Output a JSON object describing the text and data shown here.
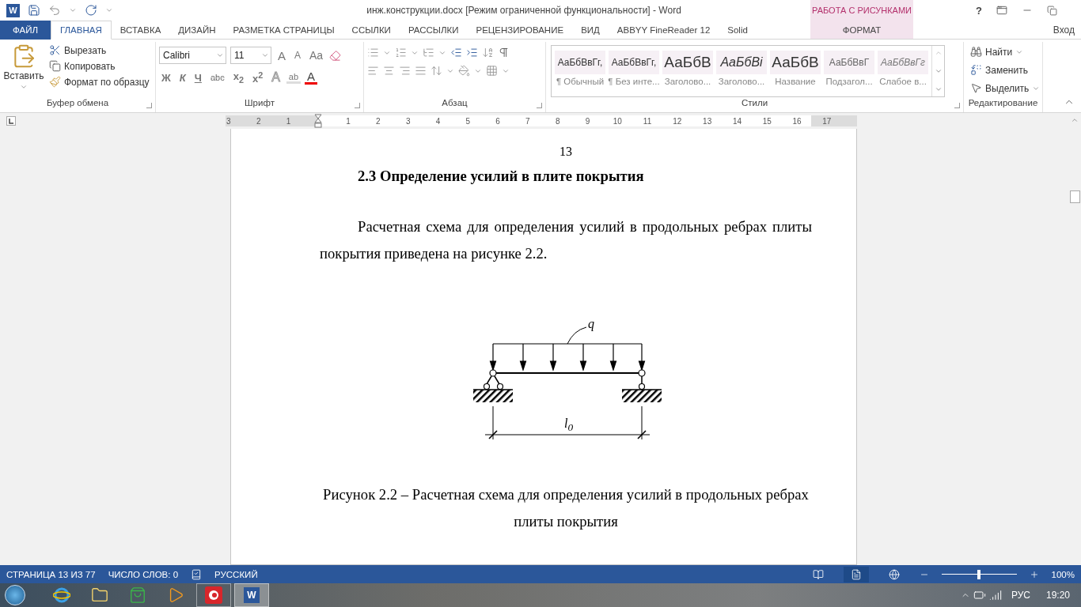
{
  "title_bar": {
    "logo": "W",
    "title": "инж.конструкции.docx [Режим ограниченной функциональности] - Word",
    "context_group": "РАБОТА С РИСУНКАМИ",
    "help": "?"
  },
  "tabs": [
    {
      "label": "ФАЙЛ",
      "kind": "file",
      "selected": false
    },
    {
      "label": "ГЛАВНАЯ",
      "kind": "normal",
      "selected": true
    },
    {
      "label": "ВСТАВКА",
      "kind": "normal",
      "selected": false
    },
    {
      "label": "ДИЗАЙН",
      "kind": "normal",
      "selected": false
    },
    {
      "label": "РАЗМЕТКА СТРАНИЦЫ",
      "kind": "normal",
      "selected": false
    },
    {
      "label": "ССЫЛКИ",
      "kind": "normal",
      "selected": false
    },
    {
      "label": "РАССЫЛКИ",
      "kind": "normal",
      "selected": false
    },
    {
      "label": "РЕЦЕНЗИРОВАНИЕ",
      "kind": "normal",
      "selected": false
    },
    {
      "label": "ВИД",
      "kind": "normal",
      "selected": false
    },
    {
      "label": "ABBYY FineReader 12",
      "kind": "normal",
      "selected": false
    },
    {
      "label": "Solid",
      "kind": "normal",
      "selected": false
    },
    {
      "label": "ФОРМАТ",
      "kind": "context",
      "selected": false
    }
  ],
  "account": "Вход",
  "clipboard": {
    "paste": "Вставить",
    "cut": "Вырезать",
    "copy": "Копировать",
    "format_painter": "Формат по образцу",
    "label": "Буфер обмена"
  },
  "font": {
    "name": "Calibri",
    "size": "11",
    "label": "Шрифт",
    "size_buttons": [
      {
        "kind": "grow",
        "text": "A"
      },
      {
        "kind": "shrink",
        "text": "A"
      },
      {
        "kind": "case",
        "text": "Aa"
      }
    ],
    "format_buttons": [
      {
        "kind": "bold",
        "text": "Ж"
      },
      {
        "kind": "italic",
        "text": "К"
      },
      {
        "kind": "underline",
        "text": "Ч"
      },
      {
        "kind": "strike",
        "text": "abc"
      },
      {
        "kind": "sub",
        "text": "x$_{2}$"
      },
      {
        "kind": "sup",
        "text": "x$^{2}$"
      },
      {
        "kind": "effects",
        "text": "A"
      },
      {
        "kind": "highlight",
        "text": "ab"
      },
      {
        "kind": "color",
        "text": "A"
      }
    ]
  },
  "paragraph": {
    "label": "Абзац"
  },
  "styles": {
    "label": "Стили",
    "items": [
      {
        "preview": "АаБбВвГг,",
        "name": "¶ Обычный",
        "kind": "normal"
      },
      {
        "preview": "АаБбВвГг,",
        "name": "¶ Без инте...",
        "kind": "normal"
      },
      {
        "preview": "АаБбВ",
        "name": "Заголово...",
        "kind": "heading"
      },
      {
        "preview": "АаБбВі",
        "name": "Заголово...",
        "kind": "heading_italic"
      },
      {
        "preview": "АаБбВ",
        "name": "Название",
        "kind": "title"
      },
      {
        "preview": "АаБбВвГ",
        "name": "Подзагол...",
        "kind": "subtitle"
      },
      {
        "preview": "АаБбВвГг",
        "name": "Слабое в...",
        "kind": "subtle"
      }
    ]
  },
  "editing": {
    "find": "Найти",
    "replace": "Заменить",
    "select": "Выделить",
    "label": "Редактирование"
  },
  "ruler": {
    "left_marks": [
      "3",
      "2",
      "1"
    ],
    "right_marks": [
      "1",
      "2",
      "3",
      "4",
      "5",
      "6",
      "7",
      "8",
      "9",
      "10",
      "11",
      "12",
      "13",
      "14",
      "15",
      "16",
      "17"
    ]
  },
  "document": {
    "page_number": "13",
    "heading": "2.3 Определение усилий в плите покрытия",
    "paragraph": "Расчетная схема для определения усилий в продольных ребрах плиты покрытия приведена на рисунке 2.2.",
    "figure": {
      "load_label": "q",
      "span_label": "l$_{0}$"
    },
    "caption": "Рисунок 2.2 – Расчетная схема для определения усилий в продольных ребрах плиты покрытия"
  },
  "status_bar": {
    "page": "СТРАНИЦА 13 ИЗ 77",
    "words": "ЧИСЛО СЛОВ: 0",
    "language": "РУССКИЙ",
    "views": [
      {
        "kind": "read",
        "selected": false
      },
      {
        "kind": "print",
        "selected": true
      },
      {
        "kind": "web",
        "selected": false
      }
    ],
    "zoom": {
      "level": 0.5,
      "reading": "100%"
    }
  },
  "taskbar": {
    "apps": [
      {
        "kind": "browser",
        "running": false,
        "selected": false
      },
      {
        "kind": "folder",
        "running": false,
        "selected": false
      },
      {
        "kind": "store",
        "running": false,
        "selected": false
      },
      {
        "kind": "player",
        "running": false,
        "selected": false
      },
      {
        "kind": "red_app",
        "running": true,
        "selected": false
      },
      {
        "kind": "word",
        "label": "W",
        "running": true,
        "selected": true
      }
    ],
    "language": "РУС",
    "clock": "19:20"
  }
}
